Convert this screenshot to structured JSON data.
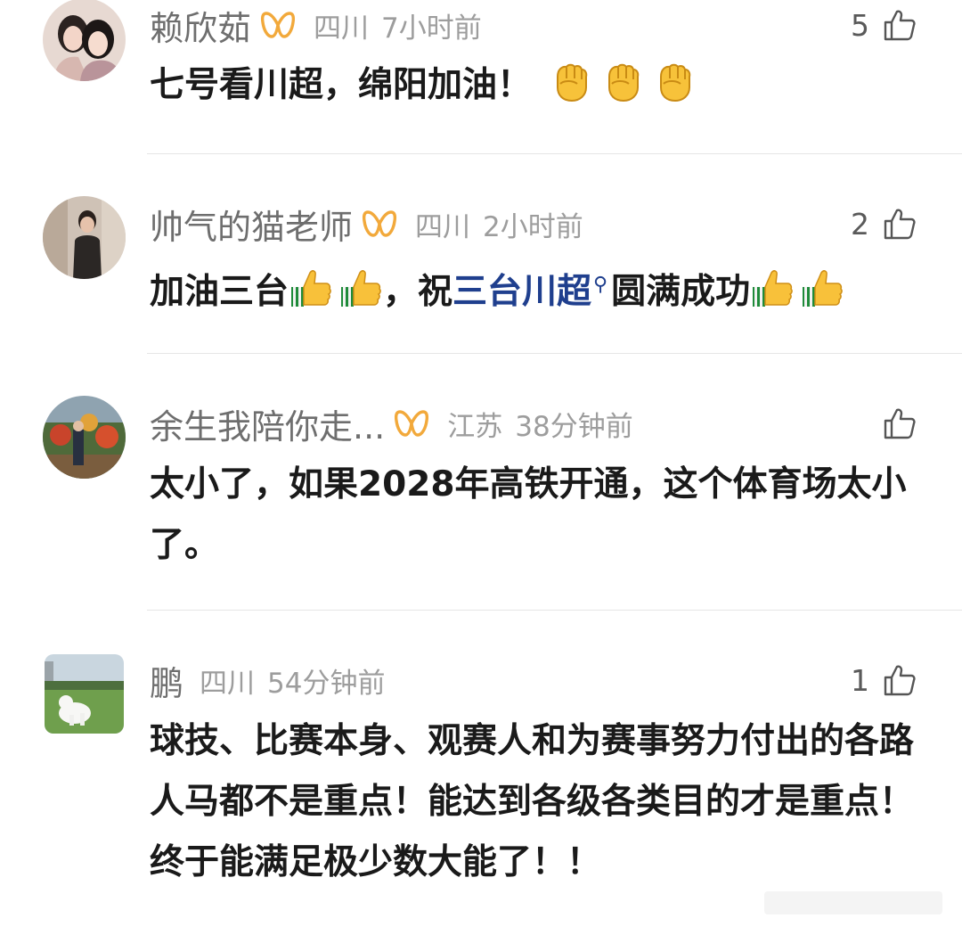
{
  "comments": [
    {
      "name": "赖欣茹",
      "region": "四川",
      "time": "7小时前",
      "likes": "5",
      "text": "七号看川超，绵阳加油！"
    },
    {
      "name": "帅气的猫老师",
      "region": "四川",
      "time": "2小时前",
      "likes": "2",
      "text_part1": "加油三台",
      "text_part2": "，祝",
      "link": "三台川超",
      "text_part3": "圆满成功"
    },
    {
      "name": "余生我陪你走...",
      "region": "江苏",
      "time": "38分钟前",
      "likes": "",
      "text": "太小了，如果2028年高铁开通，这个体育场太小了。"
    },
    {
      "name": "鹏",
      "region": "四川",
      "time": "54分钟前",
      "likes": "1",
      "text": "球技、比赛本身、观赛人和为赛事努力付出的各路人马都不是重点！能达到各级各类目的才是重点！终于能满足极少数大能了！！"
    }
  ],
  "colors": {
    "vip_badge": "#f2a93b",
    "link": "#1f3f8e"
  },
  "icons": [
    "thumb-up-icon",
    "vip-badge-icon",
    "search-icon",
    "raised-fist-emoji",
    "thumbs-up-emoji"
  ]
}
